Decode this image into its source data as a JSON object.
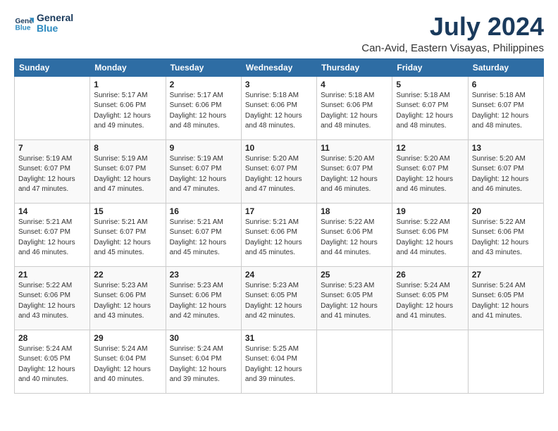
{
  "header": {
    "logo_line1": "General",
    "logo_line2": "Blue",
    "title": "July 2024",
    "subtitle": "Can-Avid, Eastern Visayas, Philippines"
  },
  "calendar": {
    "weekdays": [
      "Sunday",
      "Monday",
      "Tuesday",
      "Wednesday",
      "Thursday",
      "Friday",
      "Saturday"
    ],
    "weeks": [
      [
        {
          "day": "",
          "info": ""
        },
        {
          "day": "1",
          "info": "Sunrise: 5:17 AM\nSunset: 6:06 PM\nDaylight: 12 hours\nand 49 minutes."
        },
        {
          "day": "2",
          "info": "Sunrise: 5:17 AM\nSunset: 6:06 PM\nDaylight: 12 hours\nand 48 minutes."
        },
        {
          "day": "3",
          "info": "Sunrise: 5:18 AM\nSunset: 6:06 PM\nDaylight: 12 hours\nand 48 minutes."
        },
        {
          "day": "4",
          "info": "Sunrise: 5:18 AM\nSunset: 6:06 PM\nDaylight: 12 hours\nand 48 minutes."
        },
        {
          "day": "5",
          "info": "Sunrise: 5:18 AM\nSunset: 6:07 PM\nDaylight: 12 hours\nand 48 minutes."
        },
        {
          "day": "6",
          "info": "Sunrise: 5:18 AM\nSunset: 6:07 PM\nDaylight: 12 hours\nand 48 minutes."
        }
      ],
      [
        {
          "day": "7",
          "info": "Sunrise: 5:19 AM\nSunset: 6:07 PM\nDaylight: 12 hours\nand 47 minutes."
        },
        {
          "day": "8",
          "info": "Sunrise: 5:19 AM\nSunset: 6:07 PM\nDaylight: 12 hours\nand 47 minutes."
        },
        {
          "day": "9",
          "info": "Sunrise: 5:19 AM\nSunset: 6:07 PM\nDaylight: 12 hours\nand 47 minutes."
        },
        {
          "day": "10",
          "info": "Sunrise: 5:20 AM\nSunset: 6:07 PM\nDaylight: 12 hours\nand 47 minutes."
        },
        {
          "day": "11",
          "info": "Sunrise: 5:20 AM\nSunset: 6:07 PM\nDaylight: 12 hours\nand 46 minutes."
        },
        {
          "day": "12",
          "info": "Sunrise: 5:20 AM\nSunset: 6:07 PM\nDaylight: 12 hours\nand 46 minutes."
        },
        {
          "day": "13",
          "info": "Sunrise: 5:20 AM\nSunset: 6:07 PM\nDaylight: 12 hours\nand 46 minutes."
        }
      ],
      [
        {
          "day": "14",
          "info": "Sunrise: 5:21 AM\nSunset: 6:07 PM\nDaylight: 12 hours\nand 46 minutes."
        },
        {
          "day": "15",
          "info": "Sunrise: 5:21 AM\nSunset: 6:07 PM\nDaylight: 12 hours\nand 45 minutes."
        },
        {
          "day": "16",
          "info": "Sunrise: 5:21 AM\nSunset: 6:07 PM\nDaylight: 12 hours\nand 45 minutes."
        },
        {
          "day": "17",
          "info": "Sunrise: 5:21 AM\nSunset: 6:06 PM\nDaylight: 12 hours\nand 45 minutes."
        },
        {
          "day": "18",
          "info": "Sunrise: 5:22 AM\nSunset: 6:06 PM\nDaylight: 12 hours\nand 44 minutes."
        },
        {
          "day": "19",
          "info": "Sunrise: 5:22 AM\nSunset: 6:06 PM\nDaylight: 12 hours\nand 44 minutes."
        },
        {
          "day": "20",
          "info": "Sunrise: 5:22 AM\nSunset: 6:06 PM\nDaylight: 12 hours\nand 43 minutes."
        }
      ],
      [
        {
          "day": "21",
          "info": "Sunrise: 5:22 AM\nSunset: 6:06 PM\nDaylight: 12 hours\nand 43 minutes."
        },
        {
          "day": "22",
          "info": "Sunrise: 5:23 AM\nSunset: 6:06 PM\nDaylight: 12 hours\nand 43 minutes."
        },
        {
          "day": "23",
          "info": "Sunrise: 5:23 AM\nSunset: 6:06 PM\nDaylight: 12 hours\nand 42 minutes."
        },
        {
          "day": "24",
          "info": "Sunrise: 5:23 AM\nSunset: 6:05 PM\nDaylight: 12 hours\nand 42 minutes."
        },
        {
          "day": "25",
          "info": "Sunrise: 5:23 AM\nSunset: 6:05 PM\nDaylight: 12 hours\nand 41 minutes."
        },
        {
          "day": "26",
          "info": "Sunrise: 5:24 AM\nSunset: 6:05 PM\nDaylight: 12 hours\nand 41 minutes."
        },
        {
          "day": "27",
          "info": "Sunrise: 5:24 AM\nSunset: 6:05 PM\nDaylight: 12 hours\nand 41 minutes."
        }
      ],
      [
        {
          "day": "28",
          "info": "Sunrise: 5:24 AM\nSunset: 6:05 PM\nDaylight: 12 hours\nand 40 minutes."
        },
        {
          "day": "29",
          "info": "Sunrise: 5:24 AM\nSunset: 6:04 PM\nDaylight: 12 hours\nand 40 minutes."
        },
        {
          "day": "30",
          "info": "Sunrise: 5:24 AM\nSunset: 6:04 PM\nDaylight: 12 hours\nand 39 minutes."
        },
        {
          "day": "31",
          "info": "Sunrise: 5:25 AM\nSunset: 6:04 PM\nDaylight: 12 hours\nand 39 minutes."
        },
        {
          "day": "",
          "info": ""
        },
        {
          "day": "",
          "info": ""
        },
        {
          "day": "",
          "info": ""
        }
      ]
    ]
  }
}
